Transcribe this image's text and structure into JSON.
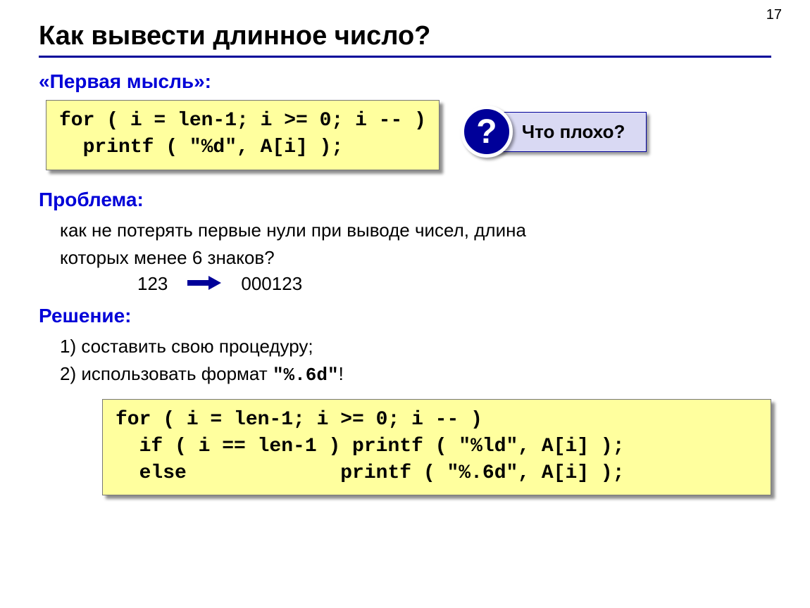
{
  "page_number": "17",
  "title": "Как вывести длинное число?",
  "first_thought_label": "«Первая мысль»:",
  "code1_line1": "for ( i = len-1; i >= 0; i -- )",
  "code1_line2": "  printf ( \"%d\", A[i] );",
  "question_mark": "?",
  "question_text": "Что плохо?",
  "problem_label": "Проблема:",
  "problem_text_line1": "как не потерять первые нули при выводе чисел, длина",
  "problem_text_line2": "которых менее 6 знаков?",
  "example_before": "123",
  "example_after": "000123",
  "solution_label": "Решение:",
  "solution_item1": "1) составить свою процедуру;",
  "solution_item2_prefix": "2) использовать формат ",
  "solution_item2_code": "\"%.6d\"",
  "solution_item2_suffix": "!",
  "code2_line1": "for ( i = len-1; i >= 0; i -- )",
  "code2_line2": "  if ( i == len-1 ) printf ( \"%ld\", A[i] );",
  "code2_line3": "  else             printf ( \"%.6d\", A[i] );"
}
